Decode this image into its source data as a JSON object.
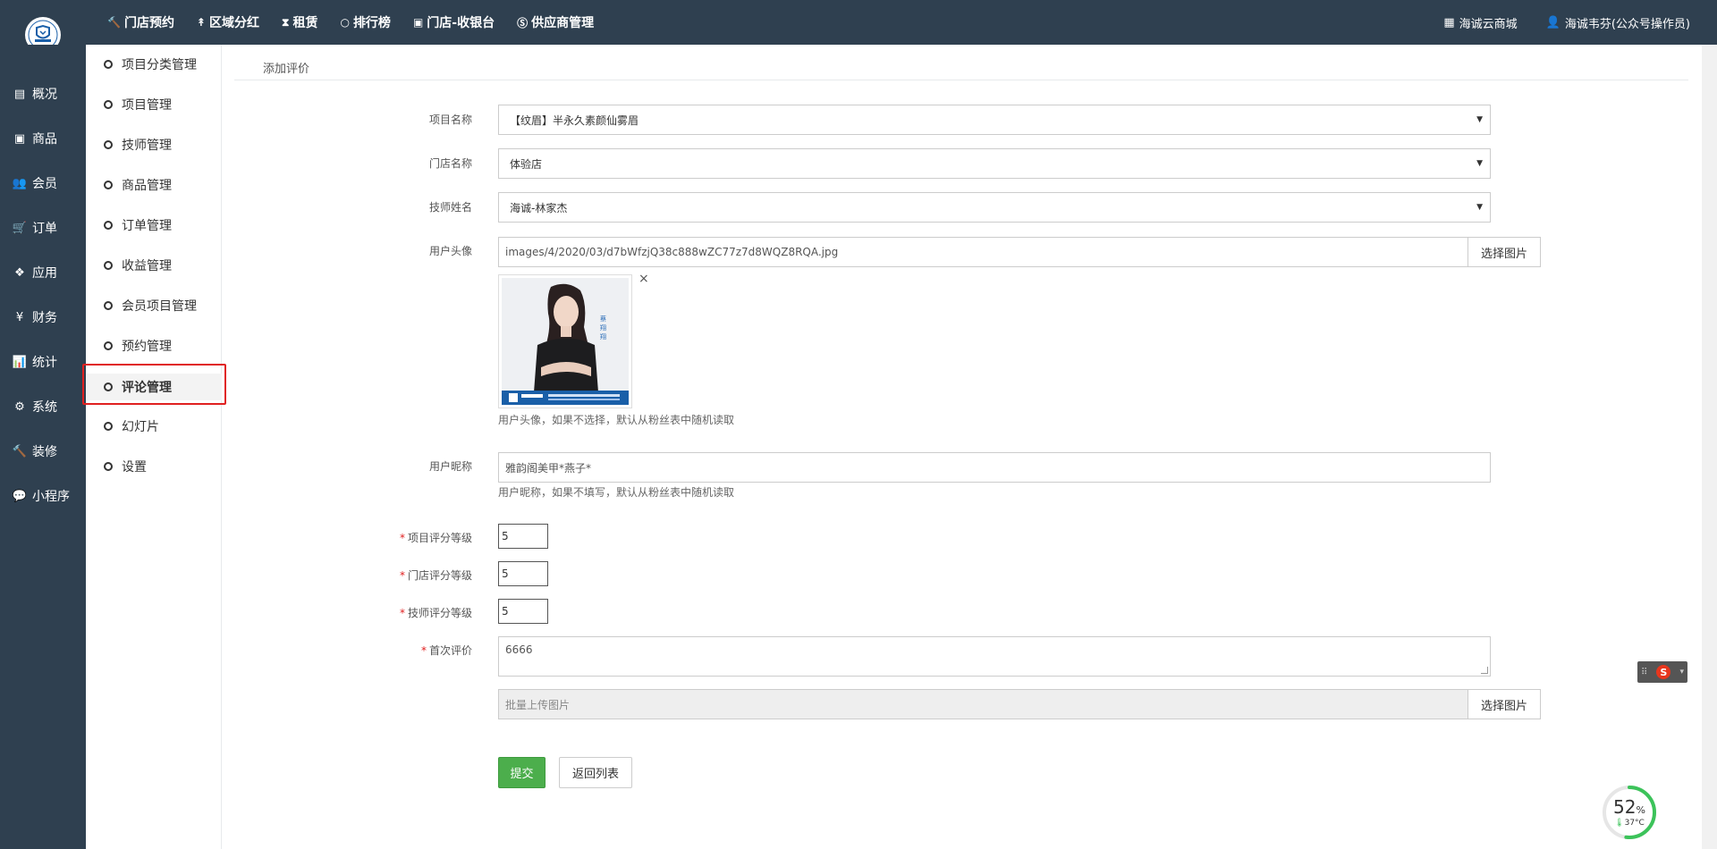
{
  "topnav": {
    "items": [
      {
        "label": "门店预约",
        "icon": "gavel-icon"
      },
      {
        "label": "区域分红",
        "icon": "pin-icon"
      },
      {
        "label": "租赁",
        "icon": "hourglass-icon"
      },
      {
        "label": "排行榜",
        "icon": "circle-icon"
      },
      {
        "label": "门店-收银台",
        "icon": "cash-icon"
      },
      {
        "label": "供应商管理",
        "icon": "skype-icon"
      }
    ],
    "right": [
      {
        "label": "海诚云商城",
        "icon": "grid-icon"
      },
      {
        "label": "海诚韦芬(公众号操作员)",
        "icon": "user-icon"
      }
    ]
  },
  "sidebar": {
    "items": [
      {
        "label": "概况",
        "icon": "inbox-icon"
      },
      {
        "label": "商品",
        "icon": "box-icon"
      },
      {
        "label": "会员",
        "icon": "users-icon"
      },
      {
        "label": "订单",
        "icon": "cart-icon"
      },
      {
        "label": "应用",
        "icon": "cubes-icon"
      },
      {
        "label": "财务",
        "icon": "yen-icon"
      },
      {
        "label": "统计",
        "icon": "bar-chart-icon"
      },
      {
        "label": "系统",
        "icon": "cogs-icon"
      },
      {
        "label": "装修",
        "icon": "hammer-icon"
      },
      {
        "label": "小程序",
        "icon": "wechat-icon"
      }
    ]
  },
  "subnav": {
    "items": [
      {
        "label": "项目分类管理"
      },
      {
        "label": "项目管理"
      },
      {
        "label": "技师管理"
      },
      {
        "label": "商品管理"
      },
      {
        "label": "订单管理"
      },
      {
        "label": "收益管理"
      },
      {
        "label": "会员项目管理"
      },
      {
        "label": "预约管理"
      },
      {
        "label": "评论管理"
      },
      {
        "label": "幻灯片"
      },
      {
        "label": "设置"
      }
    ],
    "active_index": 8
  },
  "breadcrumb": {
    "title": "添加评价"
  },
  "form": {
    "project_name": {
      "label": "项目名称",
      "value": "【纹眉】半永久素颜仙雾眉"
    },
    "store_name": {
      "label": "门店名称",
      "value": "体验店"
    },
    "technician_name": {
      "label": "技师姓名",
      "value": "海诚-林家杰"
    },
    "avatar": {
      "label": "用户头像",
      "value": "images/4/2020/03/d7bWfzjQ38c888wZC77z7d8WQZ8RQA.jpg",
      "button": "选择图片",
      "hint": "用户头像，如果不选择，默认从粉丝表中随机读取",
      "close": "×"
    },
    "nickname": {
      "label": "用户昵称",
      "value": "雅韵阁美甲*燕子*",
      "hint": "用户昵称，如果不填写，默认从粉丝表中随机读取"
    },
    "project_rating": {
      "label": "项目评分等级",
      "value": "5"
    },
    "store_rating": {
      "label": "门店评分等级",
      "value": "5"
    },
    "technician_rating": {
      "label": "技师评分等级",
      "value": "5"
    },
    "first_review": {
      "label": "首次评价",
      "value": "6666"
    },
    "batch_upload": {
      "placeholder": "批量上传图片",
      "button": "选择图片"
    },
    "required_mark": "*",
    "submit": "提交",
    "back": "返回列表"
  },
  "widget": {
    "percent": "52",
    "percent_unit": "%",
    "temperature": "37°C"
  },
  "ime": {
    "label": "S"
  },
  "colors": {
    "sidebar_bg": "#2f4050",
    "submit_bg": "#4cae4c",
    "highlight": "#e02020"
  }
}
